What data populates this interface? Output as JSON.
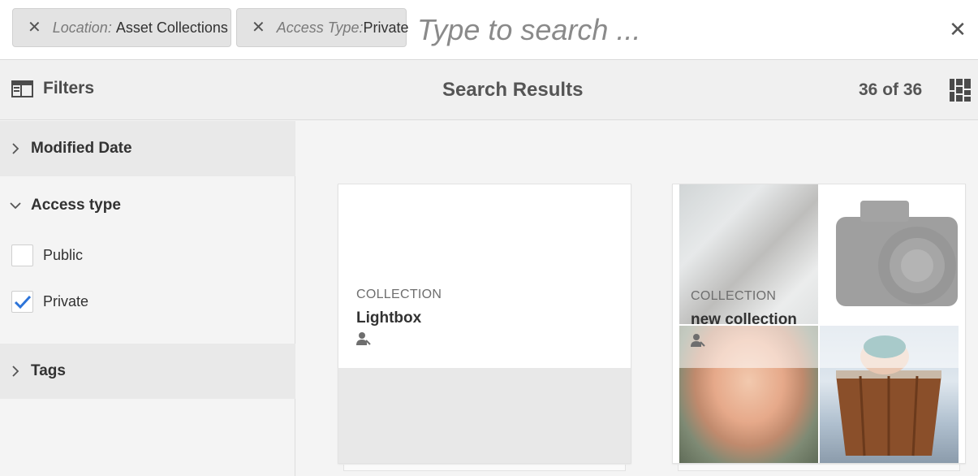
{
  "search": {
    "tags": [
      {
        "key": "Location:",
        "value": "Asset Collections"
      },
      {
        "key": "Access Type:",
        "value": "Private"
      }
    ],
    "placeholder": "Type to search ...",
    "close_label": "✕"
  },
  "header": {
    "filters_label": "Filters",
    "title": "Search Results",
    "count": "36 of 36"
  },
  "rail": {
    "sections": [
      {
        "label": "Modified Date",
        "expanded": false
      },
      {
        "label": "Access type",
        "expanded": true
      },
      {
        "label": "Tags",
        "expanded": false
      }
    ],
    "access_options": [
      {
        "label": "Public",
        "checked": false
      },
      {
        "label": "Private",
        "checked": true
      }
    ]
  },
  "cards": [
    {
      "type": "COLLECTION",
      "title": "Lightbox",
      "owner_icon": "user-icon"
    },
    {
      "type": "COLLECTION",
      "title": "new collection",
      "owner_icon": "user-icon"
    }
  ],
  "colors": {
    "accent": "#2d74d9",
    "text": "#323232"
  }
}
